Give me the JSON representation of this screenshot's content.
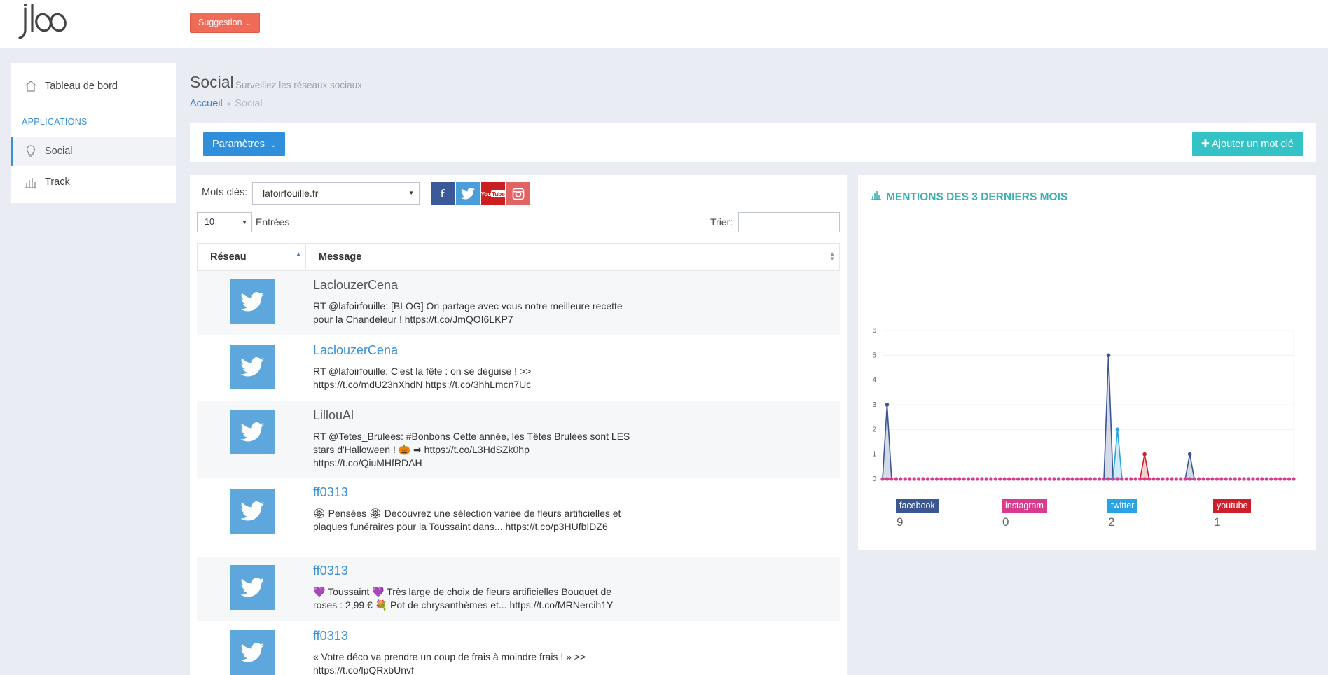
{
  "header": {
    "logo_alt": "jlao",
    "suggestion_label": "Suggestion"
  },
  "sidebar": {
    "items": [
      {
        "label": "Tableau de bord",
        "icon": "home-icon"
      },
      {
        "label": "Social",
        "icon": "lightbulb-icon"
      },
      {
        "label": "Track",
        "icon": "bar-chart-icon"
      }
    ],
    "section_label": "APPLICATIONS"
  },
  "page": {
    "title": "Social",
    "subtitle": "Surveillez les réseaux sociaux",
    "breadcrumb": {
      "home": "Accueil",
      "current": "Social"
    }
  },
  "toolbar": {
    "params_label": "Paramètres",
    "add_label": "Ajouter un mot clé"
  },
  "filters": {
    "keywords_label": "Mots clés:",
    "keyword_value": "lafoirfouille.fr",
    "entries_value": "10",
    "entries_label": "Entrées",
    "search_label": "Trier:",
    "networks": [
      {
        "name": "facebook",
        "color": "#3b5998"
      },
      {
        "name": "twitter",
        "color": "#4a9fdb"
      },
      {
        "name": "youtube",
        "color": "#cc1f1f"
      },
      {
        "name": "instagram",
        "color": "#e06464"
      }
    ]
  },
  "table": {
    "columns": [
      "Réseau",
      "Message"
    ],
    "rows": [
      {
        "network": "twitter",
        "author": "LaclouzerCena",
        "text": "RT @lafoirfouille: [BLOG] On partage avec vous notre meilleure recette pour la Chandeleur ! https://t.co/JmQOI6LKP7"
      },
      {
        "network": "twitter",
        "author": "LaclouzerCena",
        "text": "RT @lafoirfouille: C'est la fête : on se déguise ! >> https://t.co/mdU23nXhdN https://t.co/3hhLmcn7Uc"
      },
      {
        "network": "twitter",
        "author": "LillouAl",
        "text": "RT @Tetes_Brulees: #Bonbons Cette année, les Têtes Brulées sont LES stars d'Halloween ! 🎃 ➡ https://t.co/L3HdSZk0hp https://t.co/QiuMHfRDAH"
      },
      {
        "network": "twitter",
        "author": "ff0313",
        "text": "🏵 Pensées 🏵 Découvrez une sélection variée de fleurs artificielles et plaques funéraires pour la Toussaint dans... https://t.co/p3HUfbIDZ6"
      },
      {
        "network": "twitter",
        "author": "ff0313",
        "text": "💜 Toussaint 💜 Très large de choix de fleurs artificielles Bouquet de roses : 2,99 € 💐 Pot de chrysanthèmes et... https://t.co/MRNercih1Y"
      },
      {
        "network": "twitter",
        "author": "ff0313",
        "text": "« Votre déco va prendre un coup de frais à moindre frais ! » >> https://t.co/lpQRxbUnvf"
      }
    ]
  },
  "chart": {
    "title": "MENTIONS DES 3 DERNIERS MOIS",
    "legend": [
      {
        "name": "facebook",
        "count": "9",
        "color": "#3b5691"
      },
      {
        "name": "instagram",
        "count": "0",
        "color": "#d93a8e"
      },
      {
        "name": "twitter",
        "count": "2",
        "color": "#29a3e4"
      },
      {
        "name": "youtube",
        "count": "1",
        "color": "#cc1f2b"
      }
    ]
  },
  "chart_data": {
    "type": "line",
    "title": "MENTIONS DES 3 DERNIERS MOIS",
    "ylim": [
      0,
      6
    ],
    "yticks": [
      0,
      1,
      2,
      3,
      4,
      5,
      6
    ],
    "n_points": 92,
    "series": [
      {
        "name": "facebook",
        "color": "#3b5691",
        "points": [
          [
            1,
            3
          ],
          [
            50,
            5
          ],
          [
            68,
            1
          ]
        ]
      },
      {
        "name": "instagram",
        "color": "#d93a8e",
        "points": []
      },
      {
        "name": "twitter",
        "color": "#29a3e4",
        "points": [
          [
            52,
            2
          ]
        ]
      },
      {
        "name": "youtube",
        "color": "#cc1f2b",
        "points": [
          [
            58,
            1
          ]
        ]
      }
    ]
  }
}
